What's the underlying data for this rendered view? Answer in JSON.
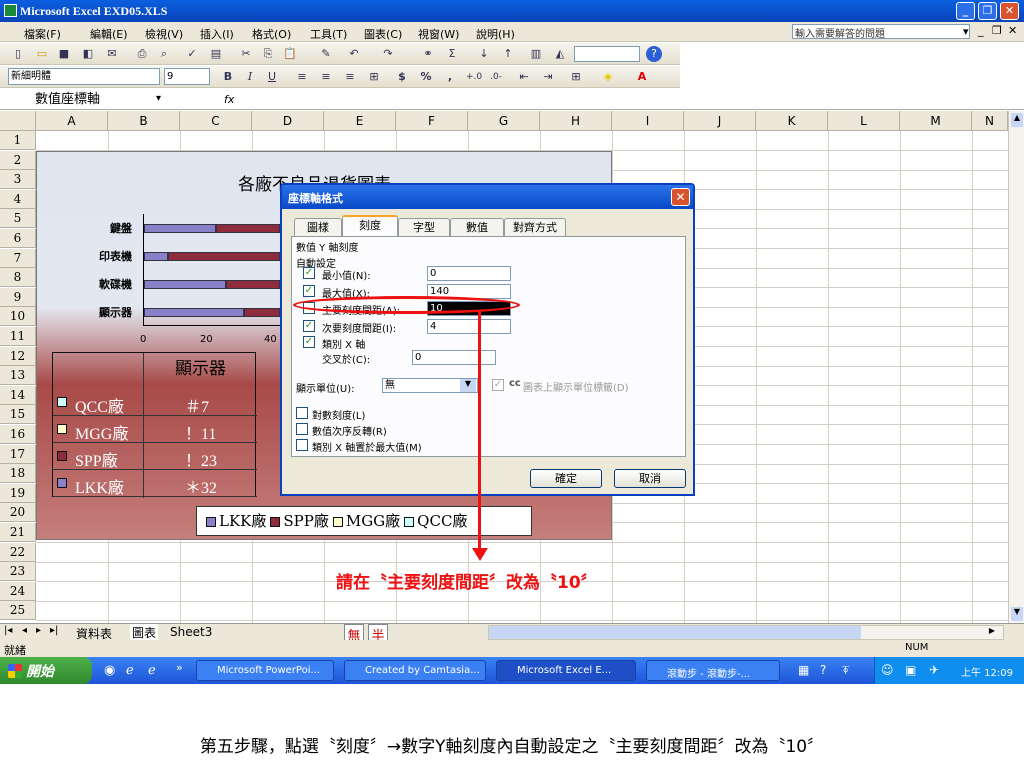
{
  "window": {
    "title": "Microsoft Excel   EXD05.XLS",
    "help_placeholder": "輸入需要解答的問題"
  },
  "menu": [
    "檔案(F)",
    "編輯(E)",
    "檢視(V)",
    "插入(I)",
    "格式(O)",
    "工具(T)",
    "圖表(C)",
    "視窗(W)",
    "說明(H)"
  ],
  "formatting": {
    "font": "新細明體",
    "size": "9",
    "bold": "B",
    "italic": "I",
    "underline": "U",
    "currency": "$",
    "percent": "%",
    "comma": ","
  },
  "formula_bar": {
    "name_box": "數值座標軸",
    "fx": "fx"
  },
  "columns": [
    "A",
    "B",
    "C",
    "D",
    "E",
    "F",
    "G",
    "H",
    "I",
    "J",
    "K",
    "L",
    "M",
    "N"
  ],
  "rows": [
    "1",
    "2",
    "3",
    "4",
    "5",
    "6",
    "7",
    "8",
    "9",
    "10",
    "11",
    "12",
    "13",
    "14",
    "15",
    "16",
    "17",
    "18",
    "19",
    "20",
    "21",
    "22",
    "23",
    "24",
    "25"
  ],
  "chart_data": {
    "type": "bar",
    "title": "各廠不良品退貨圖表",
    "categories": [
      "鍵盤",
      "印表機",
      "軟碟機",
      "顯示器"
    ],
    "x_ticks": [
      "0",
      "20",
      "40"
    ],
    "series_shown": [
      "LKK廠",
      "SPP廠",
      "MGG廠",
      "QCC廠"
    ],
    "legend": [
      "LKK廠",
      "SPP廠",
      "MGG廠",
      "QCC廠"
    ],
    "data_table": {
      "header": "顯示器",
      "rows": [
        {
          "label": "QCC廠",
          "value": "＃7"
        },
        {
          "label": "MGG廠",
          "value": "！11"
        },
        {
          "label": "SPP廠",
          "value": "！23"
        },
        {
          "label": "LKK廠",
          "value": "＊32"
        }
      ]
    },
    "colors": {
      "LKK廠": "#8a7fc9",
      "SPP廠": "#8e2c3e",
      "MGG廠": "#ffffcc",
      "QCC廠": "#ccffff"
    }
  },
  "dialog": {
    "title": "座標軸格式",
    "tabs": [
      "圖樣",
      "刻度",
      "字型",
      "數值",
      "對齊方式"
    ],
    "heading": "數值 Y 軸刻度",
    "auto": "自動設定",
    "fields": [
      {
        "label": "最小值(N):",
        "value": "0",
        "checked": true
      },
      {
        "label": "最大值(X):",
        "value": "140",
        "checked": true
      },
      {
        "label": "主要刻度間距(A):",
        "value": "10",
        "checked": false
      },
      {
        "label": "次要刻度間距(I):",
        "value": "4",
        "checked": true
      }
    ],
    "category_axis": "類別 X 軸",
    "cross_at_label": "交叉於(C):",
    "cross_at_value": "0",
    "display_unit_label": "顯示單位(U):",
    "display_unit_value": "無",
    "show_unit_label": "圖表上顯示單位標籤(D)",
    "options": [
      "對數刻度(L)",
      "數值次序反轉(R)",
      "類別 X 軸置於最大值(M)"
    ],
    "ok": "確定",
    "cancel": "取消"
  },
  "annotation": {
    "instruction": "請在〝主要刻度間距〞改為〝10〞"
  },
  "sheet_tabs": [
    "資料表",
    "圖表",
    "Sheet3"
  ],
  "status": {
    "ready": "就緒",
    "num": "NUM"
  },
  "taskbar": {
    "start": "開始",
    "tasks": [
      "Microsoft PowerPoi...",
      "Created by Camtasia...",
      "Microsoft Excel  E...",
      "滾動步 - 滾動步-..."
    ],
    "time": "上午 12:09"
  },
  "caption": "第五步驟，點選〝刻度〞→數字Y軸刻度內自動設定之〝主要刻度間距〞改為〝10〞"
}
